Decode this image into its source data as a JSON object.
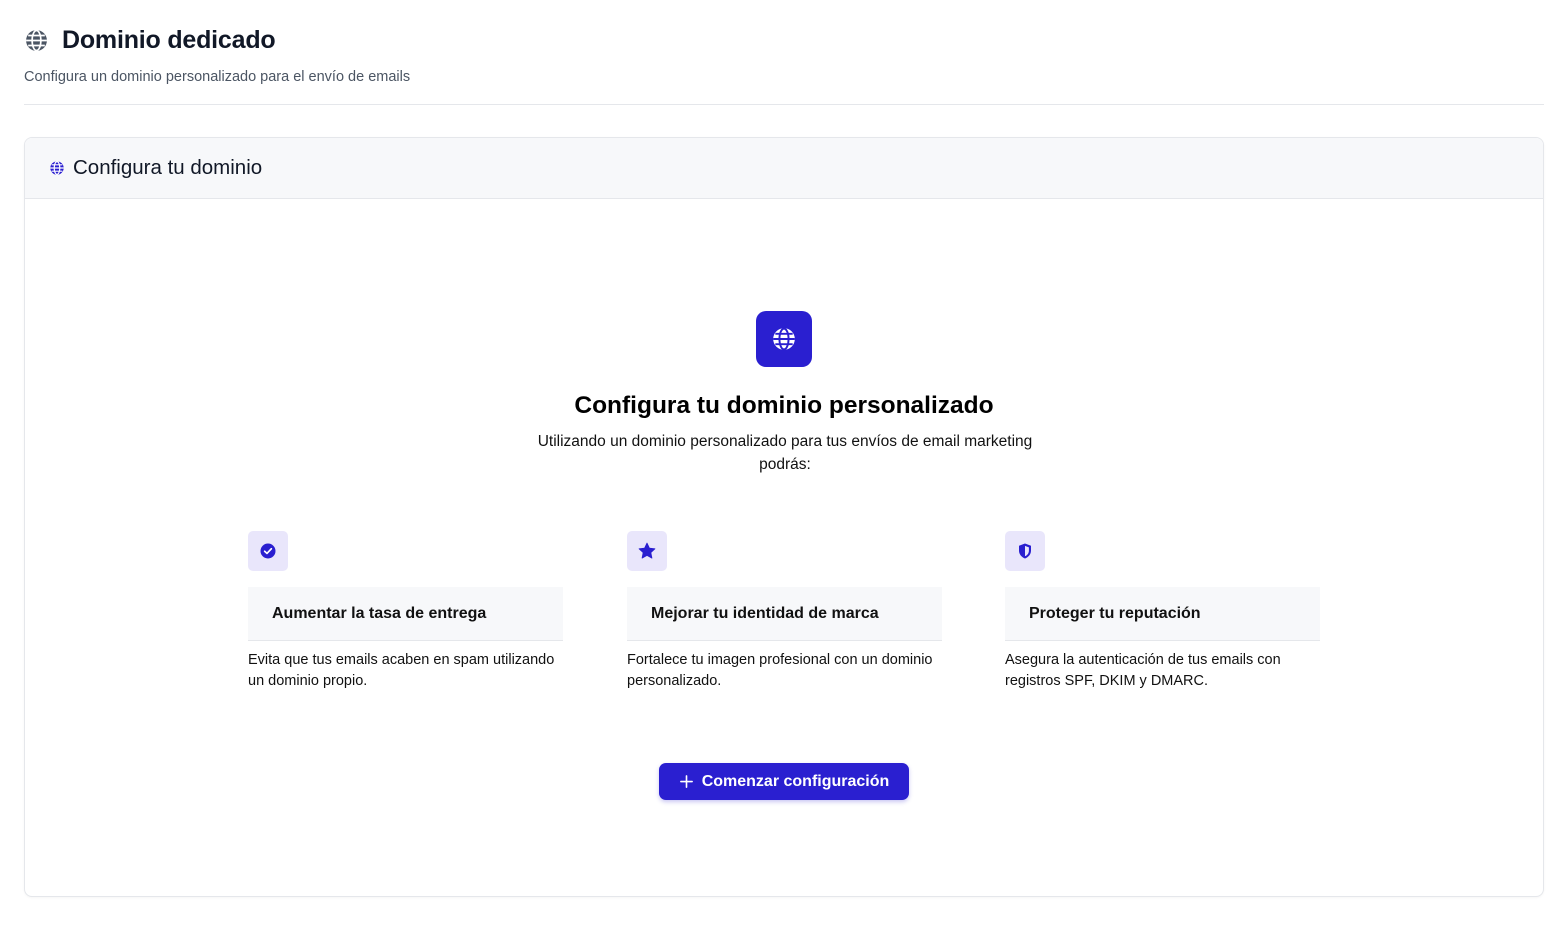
{
  "header": {
    "title": "Dominio dedicado",
    "subtitle": "Configura un dominio personalizado para el envío de emails",
    "icon": "globe-icon"
  },
  "card": {
    "title": "Configura tu dominio",
    "icon": "globe-icon"
  },
  "hero": {
    "icon": "globe-icon",
    "title": "Configura tu dominio personalizado",
    "description": "Utilizando un dominio personalizado para tus envíos de email marketing podrás:"
  },
  "features": [
    {
      "icon": "check-circle-icon",
      "title": "Aumentar la tasa de entrega",
      "description": "Evita que tus emails acaben en spam utilizando un dominio propio."
    },
    {
      "icon": "star-icon",
      "title": "Mejorar tu identidad de marca",
      "description": "Fortalece tu imagen profesional con un dominio personalizado."
    },
    {
      "icon": "shield-icon",
      "title": "Proteger tu reputación",
      "description": "Asegura la autenticación de tus emails con registros SPF, DKIM y DMARC."
    }
  ],
  "cta": {
    "label": "Comenzar configuración",
    "icon": "plus-icon"
  },
  "colors": {
    "accent": "#2a1fd0",
    "accent_soft": "#e9e6fb",
    "header_bg": "#f7f8fa",
    "border": "#e5e7eb",
    "muted_text": "#4b5563"
  }
}
